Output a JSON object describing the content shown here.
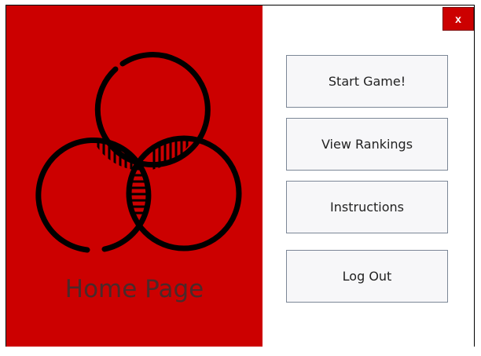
{
  "window": {
    "close_label": "x"
  },
  "left_panel": {
    "title": "Home Page",
    "logo_icon": "interlocking-rings-logo-icon",
    "background_color": "#cc0000"
  },
  "menu": {
    "start_label": "Start Game!",
    "rankings_label": "View Rankings",
    "instructions_label": "Instructions",
    "logout_label": "Log Out"
  }
}
